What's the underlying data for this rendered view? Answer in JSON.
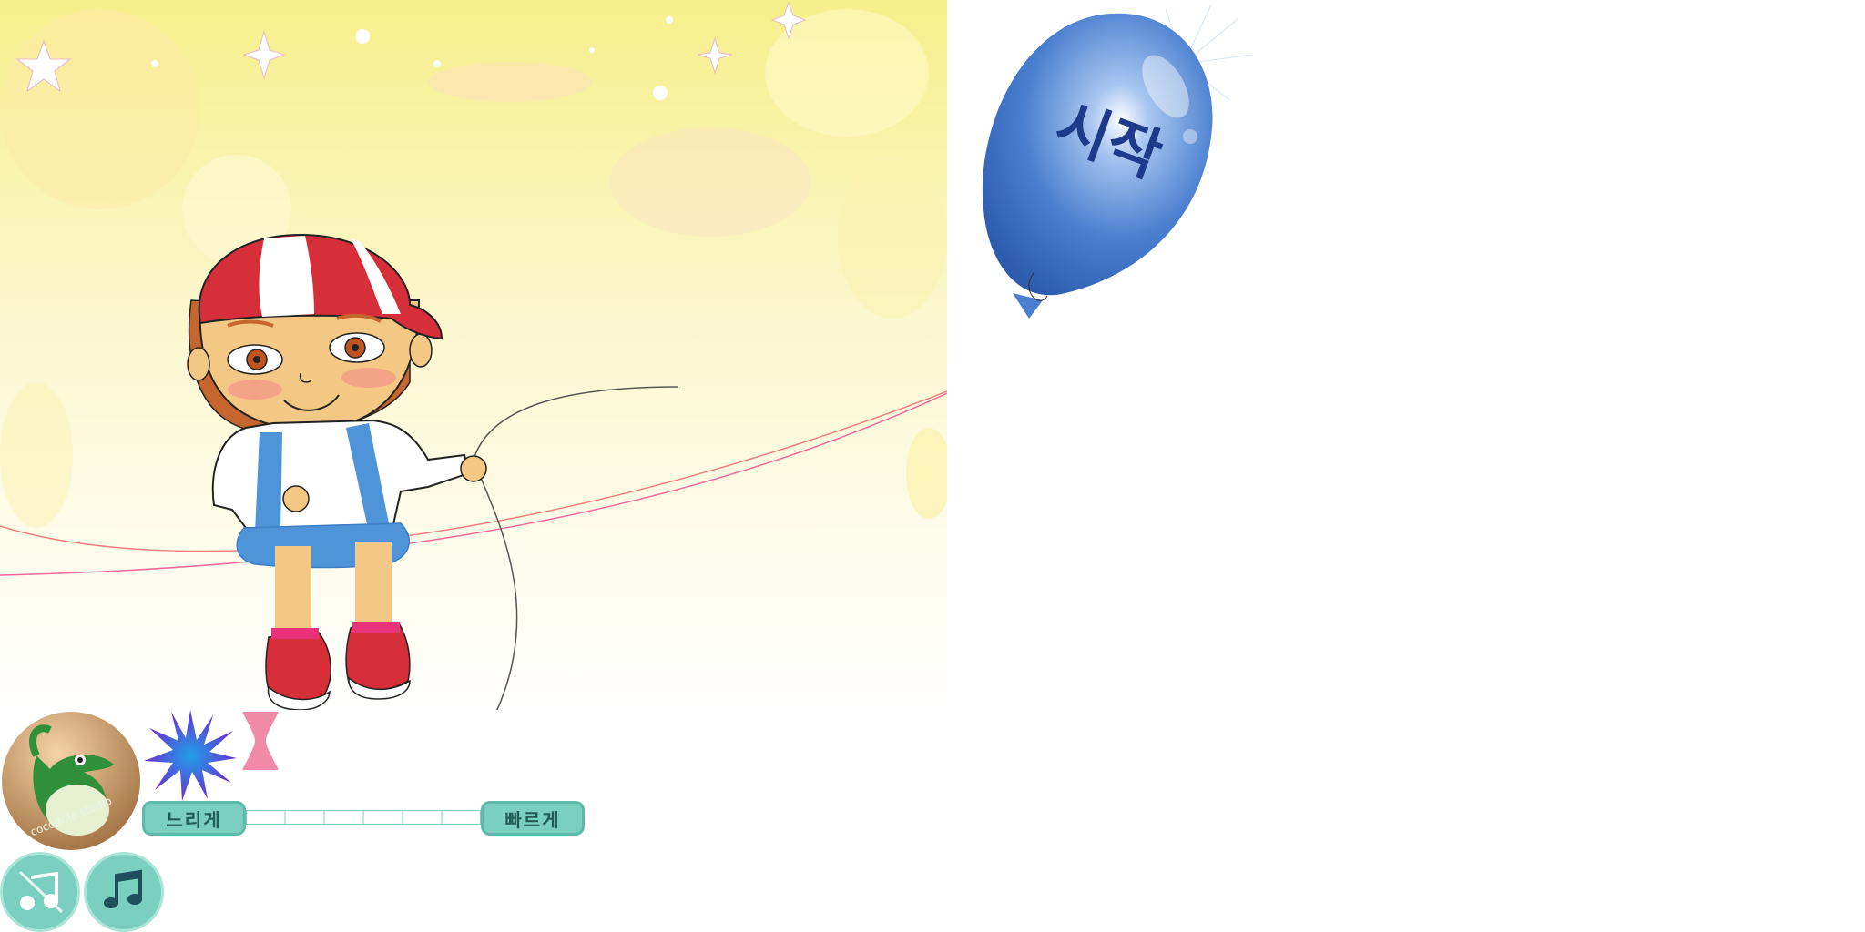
{
  "start_balloon": {
    "label": "시작",
    "color": "#4a7fcf"
  },
  "speed_control": {
    "slow_label": "느리게",
    "fast_label": "빠르게",
    "segments": 6
  },
  "logo": {
    "text": "cocodrilo studio",
    "icon": "crocodile-icon"
  },
  "music": {
    "off_icon": "music-off-icon",
    "on_icon": "music-on-icon"
  },
  "colors": {
    "button_teal": "#7bcfbe",
    "background_yellow": "#f7ef8a"
  }
}
